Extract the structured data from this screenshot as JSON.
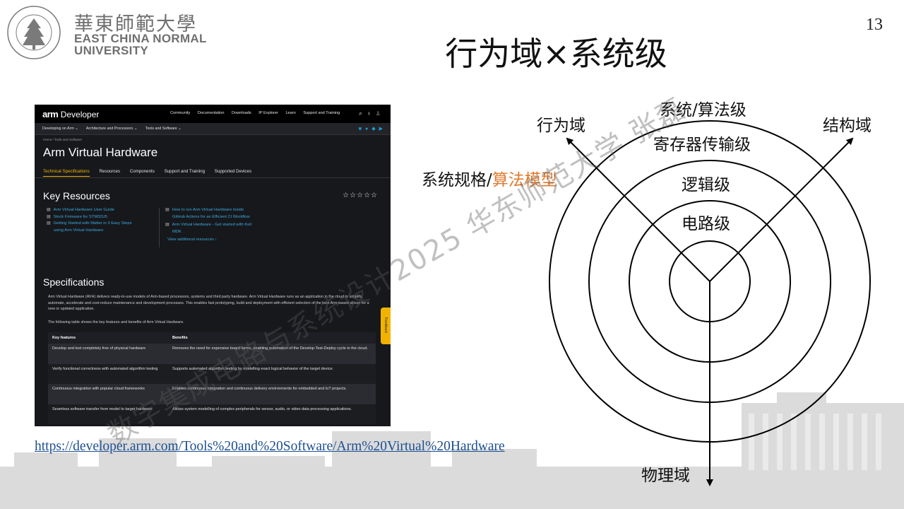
{
  "header": {
    "logo_cn": "華東師範大學",
    "logo_en_line1": "EAST CHINA NORMAL",
    "logo_en_line2": "UNIVERSITY",
    "page_number": "13",
    "title": "行为域×系统级"
  },
  "screenshot": {
    "brand_arm": "arm",
    "brand_dev": "Developer",
    "top_nav": [
      "Community",
      "Documentation",
      "Downloads",
      "IP Explorer",
      "Learn",
      "Support and Training"
    ],
    "sub_nav": [
      "Developing on Arm ⌄",
      "Architecture and Processors ⌄",
      "Tools and Software ⌄"
    ],
    "breadcrumb": "Home  /  Tools and Software",
    "page_heading": "Arm Virtual Hardware",
    "tabs": [
      "Technical Specifications",
      "Resources",
      "Components",
      "Support and Training",
      "Supported Devices"
    ],
    "key_resources_title": "Key Resources",
    "stars": "☆☆☆☆☆",
    "resources_left": [
      "Arm Virtual Hardware User Guide",
      "Stock Firmware for STM32U5",
      "Getting Started with Matter in 3 Easy Steps",
      "using Arm Virtual Hardware"
    ],
    "resources_right": [
      "How to run Arm Virtual Hardware inside",
      "GitHub Actions for an Efficient CI Workflow",
      "Arm Virtual Hardware - Get started with Keil",
      "MDK"
    ],
    "view_more": "View additional resources  ›",
    "specifications_title": "Specifications",
    "spec_paragraph": "Arm Virtual Hardware (AVH) delivers ready-to-use models of Arm-based processors, systems and third party hardware. Arm Virtual Hardware runs as an application in the cloud to simplify, automate, accelerate and cost-reduce maintenance and development processes. This enables fast prototyping, build and deployment with efficient selection of the best Arm-based silicon for a new or updated application.",
    "spec_paragraph2": "The following table shows the key features and benefits of Arm Virtual Hardware.",
    "table_headers": [
      "Key features",
      "Benefits"
    ],
    "table_rows": [
      [
        "Develop and test completely free of physical hardware",
        "Removes the need for expensive board farms, enabling automation of the Develop-Test-Deploy cycle in the cloud."
      ],
      [
        "Verify functional correctness with automated algorithm testing",
        "Supports automated algorithm testing by modelling exact logical behavior of the target device."
      ],
      [
        "Continuous integration with popular cloud frameworks",
        "Enables continuous integration and continuous delivery environments for embedded and IoT projects."
      ],
      [
        "Seamless software transfer from model to target hardware",
        "Allows system modelling of complex peripherals for sensor, audio, or video data processing applications."
      ]
    ],
    "feedback": "Feedback"
  },
  "link_text": "https://developer.arm.com/Tools%20and%20Software/Arm%20Virtual%20Hardware",
  "diagram": {
    "label_behavior": "行为域",
    "label_structure": "结构域",
    "label_physical": "物理域",
    "label_system_alg": "系统/算法级",
    "label_register": "寄存器传输级",
    "label_logic": "逻辑级",
    "label_circuit": "电路级",
    "label_spec_a": "系统规格/",
    "label_spec_b": "算法模型"
  },
  "watermark": "数字集成电路与系统设计2025 华东师范大学 张磊"
}
